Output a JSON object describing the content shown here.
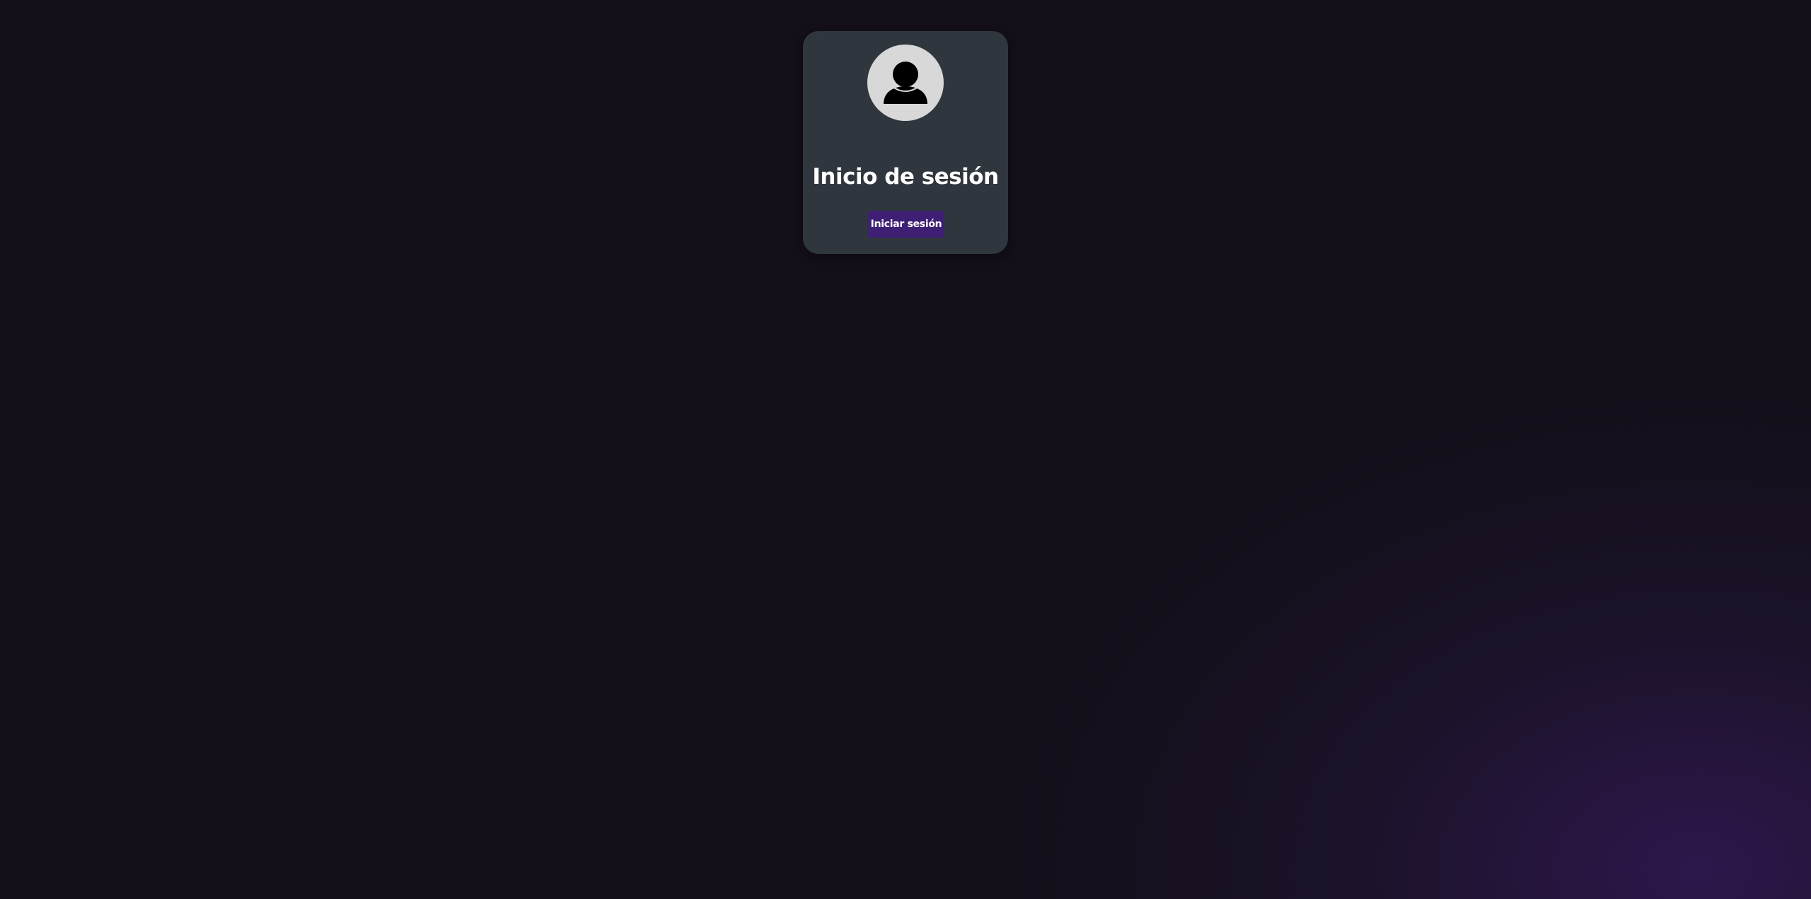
{
  "login": {
    "title": "Inicio de sesión",
    "button_label": "Iniciar sesión",
    "avatar_icon": "user-icon"
  },
  "colors": {
    "background": "#140f19",
    "background_glow": "#2e184e",
    "card": "#30363d",
    "avatar_circle": "#d8d8d8",
    "button": "#3e1f73",
    "text": "#ffffff"
  }
}
